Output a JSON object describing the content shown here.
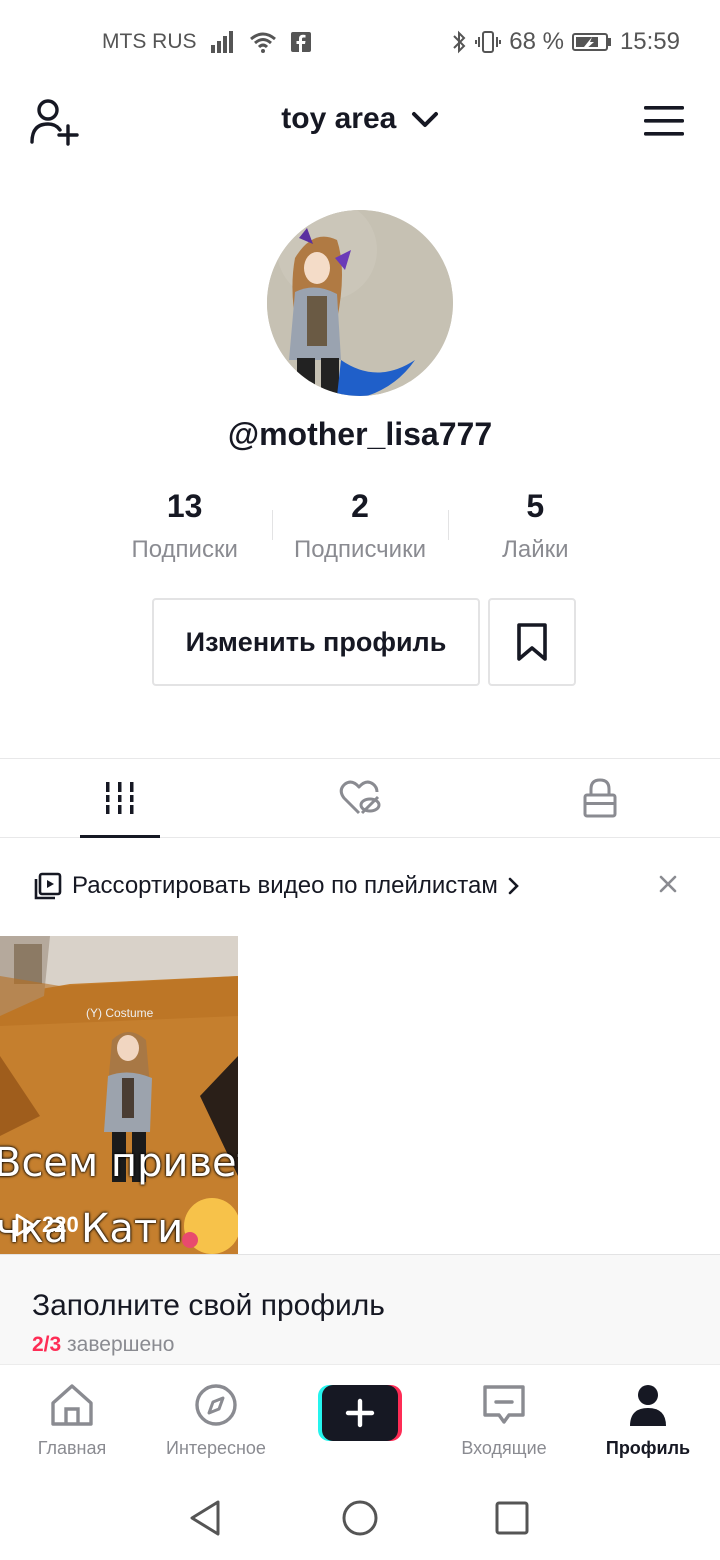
{
  "status_bar": {
    "carrier": "MTS RUS",
    "battery": "68 %",
    "time": "15:59"
  },
  "header": {
    "account_name": "toy area"
  },
  "profile": {
    "username": "@mother_lisa777",
    "stats": [
      {
        "value": "13",
        "label": "Подписки"
      },
      {
        "value": "2",
        "label": "Подписчики"
      },
      {
        "value": "5",
        "label": "Лайки"
      }
    ],
    "edit_button": "Изменить профиль"
  },
  "playlist_banner": {
    "text": "Рассортировать видео по плейлистам"
  },
  "video": {
    "overlay_line1": "Всем привет",
    "overlay_line2": "чка Кати",
    "overlay_small": "(Y) Costume",
    "views": "220"
  },
  "complete_profile": {
    "title": "Заполните свой профиль",
    "progress": "2/3",
    "status": "завершено"
  },
  "bottom_nav": {
    "home": "Главная",
    "discover": "Интересное",
    "inbox": "Входящие",
    "profile": "Профиль"
  },
  "colors": {
    "accent_red": "#fe2c55",
    "accent_cyan": "#25f4ee",
    "text_primary": "#161823",
    "text_secondary": "#8a8b91"
  }
}
